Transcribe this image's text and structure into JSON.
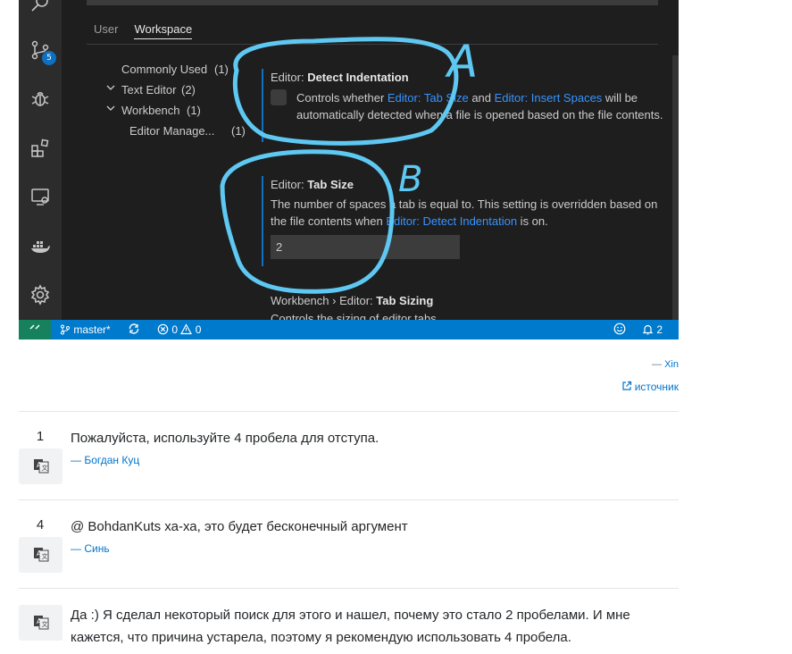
{
  "settings_tabs": [
    {
      "label": "User",
      "active": false
    },
    {
      "label": "Workspace",
      "active": true
    }
  ],
  "toc": [
    {
      "label": "Commonly Used",
      "count": "(1)",
      "expanded": null
    },
    {
      "label": "Text Editor",
      "count": "(2)",
      "expanded": true
    },
    {
      "label": "Workbench",
      "count": "(1)",
      "expanded": true
    },
    {
      "label": "Editor Manage...",
      "count": "(1)",
      "expanded": null
    }
  ],
  "setting_detect": {
    "title_prefix": "Editor: ",
    "title_name": "Detect Indentation",
    "desc_1": "Controls whether ",
    "link_1": "Editor: Tab Size",
    "desc_2": " and ",
    "link_2": "Editor: Insert Spaces",
    "desc_3": " will be automatically detected when a file is opened based on the file contents."
  },
  "setting_tabsize": {
    "title_prefix": "Editor: ",
    "title_name": "Tab Size",
    "desc_1": "The number of spaces a tab is equal to. This setting is overridden based on the file contents when ",
    "link_1": "Editor: Detect Indentation",
    "desc_2": " is on.",
    "value": "2"
  },
  "setting_tabsizing": {
    "title_prefix": "Workbench › Editor: ",
    "title_name": "Tab Sizing",
    "desc": "Controls the sizing of editor tabs."
  },
  "annotations": {
    "a": "A",
    "b": "B",
    "color": "#5ec8f2"
  },
  "statusbar": {
    "branch": "master*",
    "errors": "0",
    "warnings": "0",
    "notifications": "2",
    "scm_badge": "5"
  },
  "attribution": {
    "dash": "— ",
    "author": "Xin"
  },
  "source_link": "источник",
  "comments": [
    {
      "votes": "1",
      "text": "Пожалуйста, используйте 4 пробела для отступа.",
      "author": "Богдан Куц"
    },
    {
      "votes": "4",
      "text": "@ BohdanKuts ха-ха, это будет бесконечный аргумент",
      "author": "Синь"
    },
    {
      "votes": "",
      "text": "Да :) Я сделал некоторый поиск для этого и нашел, почему это стало 2 пробелами. И мне кажется, что причина устарела, поэтому я рекомендую использовать 4 пробела.",
      "author": ""
    }
  ],
  "author_dash": "— ",
  "colors": {
    "vscode_bg": "#1e1e1e",
    "statusbar": "#007acc",
    "link": "#3794ff",
    "so_link": "#0074cc"
  }
}
